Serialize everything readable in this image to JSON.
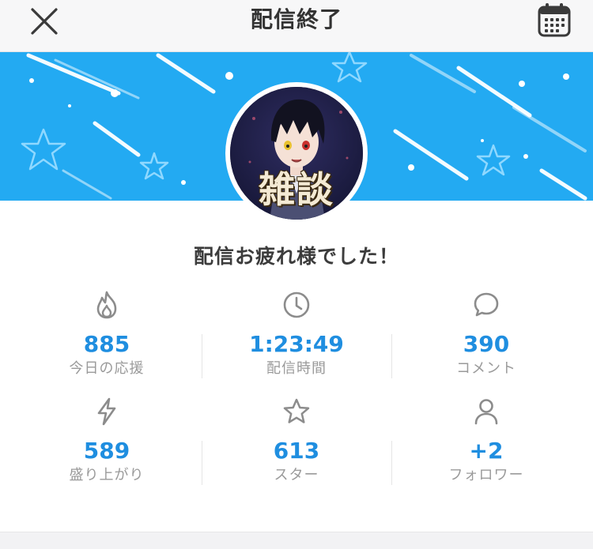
{
  "header": {
    "title": "配信終了",
    "close_icon": "close-icon",
    "calendar_icon": "calendar-icon"
  },
  "colors": {
    "banner": "#23aaf2",
    "accent": "#1f8ee0",
    "label": "#9a9a9a",
    "icon": "#8c8c8c"
  },
  "avatar": {
    "caption": "雑談"
  },
  "message": "配信お疲れ様でした！",
  "stats": [
    {
      "icon": "flame-icon",
      "value": "885",
      "label": "今日の応援"
    },
    {
      "icon": "clock-icon",
      "value": "1:23:49",
      "label": "配信時間"
    },
    {
      "icon": "comment-icon",
      "value": "390",
      "label": "コメント"
    },
    {
      "icon": "lightning-icon",
      "value": "589",
      "label": "盛り上がり"
    },
    {
      "icon": "star-icon",
      "value": "613",
      "label": "スター"
    },
    {
      "icon": "user-icon",
      "value": "+2",
      "label": "フォロワー"
    }
  ]
}
